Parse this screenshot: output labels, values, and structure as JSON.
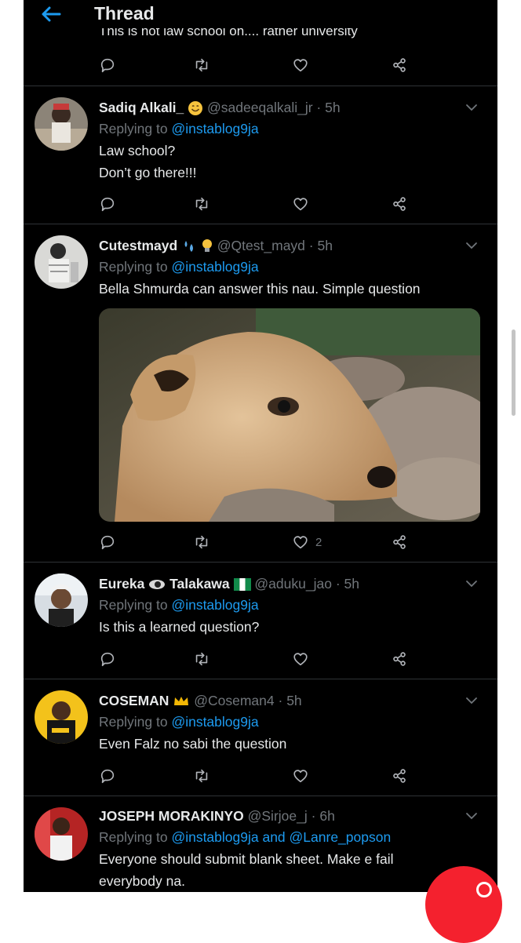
{
  "header": {
    "title": "Thread"
  },
  "partial_tweet": {
    "text": "This is not law school oh.... rather university"
  },
  "tweets": [
    {
      "name": "Sadiq Alkali_",
      "handle": "@sadeeqalkali_jr",
      "dot": "·",
      "time": "5h",
      "replying_prefix": "Replying to",
      "replying_to": "@instablog9ja",
      "lines": [
        "Law school?",
        "Don’t go there!!!"
      ]
    },
    {
      "name": "Cutestmayd",
      "handle": "@Qtest_mayd",
      "dot": "·",
      "time": "5h",
      "replying_prefix": "Replying to",
      "replying_to": "@instablog9ja",
      "lines": [
        "Bella Shmurda can answer this nau. Simple question"
      ],
      "like_count": "2"
    },
    {
      "name": "Eureka",
      "name_suffix": "Talakawa",
      "handle": "@aduku_jao",
      "dot": "·",
      "time": "5h",
      "replying_prefix": "Replying to",
      "replying_to": "@instablog9ja",
      "lines": [
        "Is this a learned question?"
      ]
    },
    {
      "name": "COSEMAN",
      "handle": "@Coseman4",
      "dot": "·",
      "time": "5h",
      "replying_prefix": "Replying to",
      "replying_to": "@instablog9ja",
      "lines": [
        "Even Falz no sabi the question"
      ]
    },
    {
      "name": "JOSEPH MORAKINYO",
      "handle": "@Sirjoe_j",
      "dot": "·",
      "time": "6h",
      "replying_prefix": "Replying to",
      "replying_to": "@instablog9ja and @Lanre_popson",
      "lines": [
        "Everyone should submit blank sheet. Make e fail",
        "everybody na."
      ]
    }
  ],
  "colors": {
    "background": "#000000",
    "text": "#e7e9ea",
    "muted": "#71767b",
    "accent": "#1d9bf0",
    "divider": "#2f3336",
    "fab": "#f4212e"
  },
  "icons": [
    "back-arrow-icon",
    "reply-icon",
    "retweet-icon",
    "like-icon",
    "share-icon",
    "chevron-down-icon",
    "compose-icon"
  ]
}
